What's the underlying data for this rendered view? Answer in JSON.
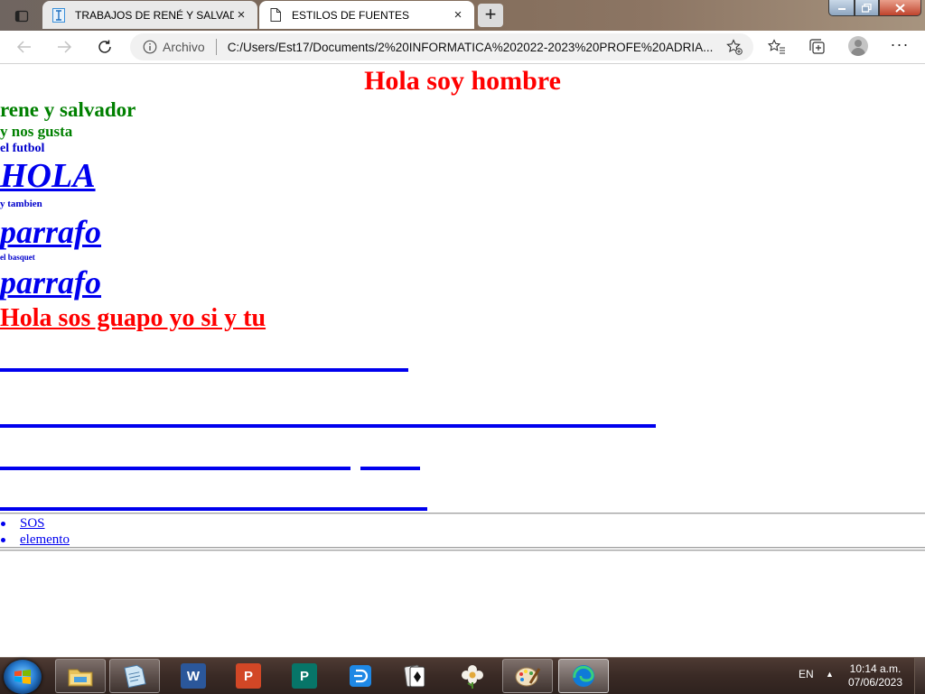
{
  "browser": {
    "tabs": [
      {
        "title": "TRABAJOS DE RENÉ Y SALVADOR",
        "close": "×",
        "favicon": "text-cursor-icon"
      },
      {
        "title": "ESTILOS DE FUENTES",
        "close": "×",
        "favicon": "page-icon"
      }
    ],
    "new_tab": "+",
    "address": {
      "security_label": "Archivo",
      "url": "C:/Users/Est17/Documents/2%20INFORMATICA%202022-2023%20PROFE%20ADRIA..."
    },
    "more": "···"
  },
  "page": {
    "heading": "Hola soy hombre",
    "line1": "rene y salvador",
    "line2": "y nos gusta",
    "line3": "el futbol",
    "hola": "HOLA",
    "small1": "y tambien",
    "parrafo1": "parrafo",
    "small2": "el basquet",
    "parrafo2": "parrafo",
    "guapo": "Hola sos guapo yo si y tu",
    "list": [
      "SOS",
      "elemento"
    ],
    "colors": {
      "red": "#ff0000",
      "green": "#008000",
      "blue": "#0000ee"
    }
  },
  "taskbar": {
    "apps": [
      "file-explorer-icon",
      "notepad-icon",
      "word-icon",
      "powerpoint-icon",
      "publisher-icon",
      "camera-icon",
      "solitaire-icon",
      "flower-icon",
      "paint-icon",
      "edge-icon"
    ],
    "word_letter": "W",
    "ppt_letter": "P",
    "pub_letter": "P",
    "lang": "EN",
    "time": "10:14 a.m.",
    "date": "07/06/2023"
  }
}
